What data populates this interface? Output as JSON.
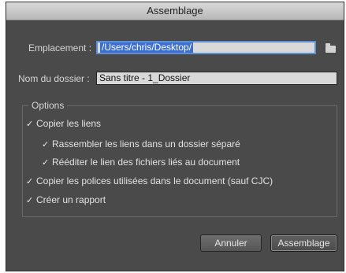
{
  "window": {
    "title": "Assemblage"
  },
  "location": {
    "label": "Emplacement :",
    "value": "/Users/chris/Desktop/"
  },
  "folder_name": {
    "label": "Nom du dossier :",
    "value": "Sans titre - 1_Dossier"
  },
  "options": {
    "title": "Options",
    "copy_links": {
      "label": "Copier les liens",
      "checked": true
    },
    "gather_links": {
      "label": "Rassembler les liens dans un dossier séparé",
      "checked": true
    },
    "relink": {
      "label": "Rééditer le lien des fichiers liés au document",
      "checked": true
    },
    "copy_fonts": {
      "label": "Copier les polices utilisées dans le document (sauf CJC)",
      "checked": true
    },
    "create_report": {
      "label": "Créer un rapport",
      "checked": true
    }
  },
  "buttons": {
    "cancel": "Annuler",
    "package": "Assemblage"
  },
  "icons": {
    "folder": "folder-icon",
    "check": "checkmark-icon"
  }
}
